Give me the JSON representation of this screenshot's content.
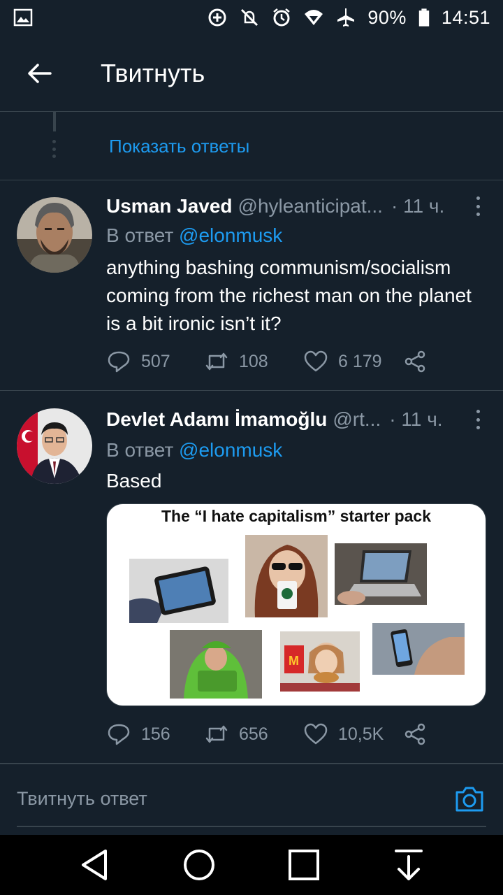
{
  "status_bar": {
    "battery": "90%",
    "time": "14:51",
    "icons": [
      "image-icon",
      "data-saver-icon",
      "mute-icon",
      "alarm-icon",
      "wifi-icon",
      "airplane-icon",
      "battery-icon"
    ]
  },
  "header": {
    "title": "Твитнуть",
    "back_icon": "arrow-left-icon"
  },
  "thread": {
    "show_replies_label": "Показать ответы"
  },
  "tweets": [
    {
      "name": "Usman Javed",
      "handle": "@hyleanticipat...",
      "time": "· 11 ч.",
      "reply_prefix": "В ответ",
      "reply_to": "@elonmusk",
      "text": "anything bashing communism/socialism coming from the richest man on the planet is a bit ironic isn’t it?",
      "replies": "507",
      "retweets": "108",
      "likes": "6 179"
    },
    {
      "name": "Devlet Adamı İmamoğlu",
      "handle": "@rt...",
      "time": "· 11 ч.",
      "reply_prefix": "В ответ",
      "reply_to": "@elonmusk",
      "text": "Based",
      "media_caption": "The “I hate capitalism” starter pack",
      "replies": "156",
      "retweets": "656",
      "likes": "10,5K"
    }
  ],
  "reply_bar": {
    "placeholder": "Твитнуть ответ"
  },
  "colors": {
    "background": "#15202b",
    "accent": "#1d9bf0",
    "muted": "#8b98a5",
    "divider": "#38444d"
  }
}
